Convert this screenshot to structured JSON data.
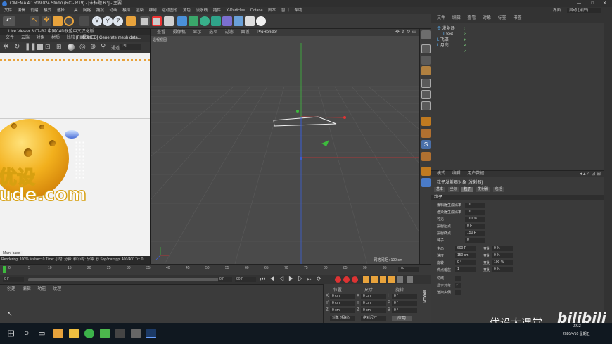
{
  "window": {
    "title": "CINEMA 4D R19.024 Studio (RC - R19) - [未标题 6 *] - 主要"
  },
  "menubar": [
    "文件",
    "编辑",
    "创建",
    "模式",
    "选择",
    "工具",
    "网格",
    "捕捉",
    "动画",
    "模拟",
    "渲染",
    "雕刻",
    "运动图形",
    "角色",
    "流水线",
    "插件",
    "X-Particles",
    "Octane",
    "脚本",
    "窗口",
    "帮助"
  ],
  "layout_label": "界面",
  "layout_value": "启动 (用户)",
  "live_viewer": {
    "title": "Live Viewer 3.07-R2 中国C4D联盟中文汉化版",
    "menu": [
      "文件",
      "云端",
      "对象",
      "材质",
      "比较",
      "帮助"
    ],
    "status_msg": "[FINISHED] Generate mesh data...",
    "render_label": "PT",
    "status_line": "Rendering: 100%   Ms/sec: 0   Time: 小时: 分钟: 秒/小时: 分钟: 秒   Spp/maxspp: 400/400   Tri: 0",
    "main_label": "Main: base"
  },
  "viewport": {
    "menu": [
      "查看",
      "摄像机",
      "显示",
      "选项",
      "过滤",
      "面板",
      "ProRender"
    ],
    "camera_label": "透视视图",
    "grid_scale": "网格间距 : 100 cm"
  },
  "object_manager": {
    "menu": [
      "文件",
      "编辑",
      "查看",
      "对象",
      "标签",
      "书签"
    ],
    "objects": [
      {
        "name": "发射器",
        "level": 0
      },
      {
        "name": "text",
        "level": 1
      },
      {
        "name": "飞碟",
        "level": 0
      },
      {
        "name": "月亮",
        "level": 0
      }
    ]
  },
  "attribute_manager": {
    "menu": [
      "模式",
      "编辑",
      "用户数据"
    ],
    "title": "粒子发射器对象 [发射器]",
    "tabs": [
      "基本",
      "坐标",
      "粒子",
      "发射器",
      "包括"
    ],
    "active_tab": "粒子",
    "section": "粒子",
    "params": [
      {
        "label": "编辑器生成比率",
        "value": "10"
      },
      {
        "label": "渲染器生成比率",
        "value": "10"
      },
      {
        "label": "可见",
        "value": "100 %"
      },
      {
        "label": "投射起点",
        "value": "0 F"
      },
      {
        "label": "投射终点",
        "value": "150 F"
      },
      {
        "label": "种子",
        "value": "0"
      },
      {
        "label": "生命",
        "value": "600 F",
        "var_label": "变化",
        "var_value": "0 %"
      },
      {
        "label": "速度",
        "value": "150 cm",
        "var_label": "变化",
        "var_value": "0 %"
      },
      {
        "label": "旋转",
        "value": "0 °",
        "var_label": "变化",
        "var_value": "100 %"
      },
      {
        "label": "终点缩放",
        "value": "1",
        "var_label": "变化",
        "var_value": "0 %"
      },
      {
        "label": "切线",
        "value": ""
      },
      {
        "label": "显示对象",
        "value": "✓"
      },
      {
        "label": "渲染实例",
        "value": ""
      }
    ]
  },
  "timeline": {
    "ticks": [
      "0",
      "5",
      "10",
      "15",
      "20",
      "25",
      "30",
      "35",
      "40",
      "45",
      "50",
      "55",
      "60",
      "65",
      "70",
      "75",
      "80",
      "85",
      "90",
      "95"
    ],
    "current_frame": "0 F",
    "start": "0 F",
    "end": "90 F",
    "field_a": "0 F",
    "field_b": "90 F"
  },
  "materials": {
    "menu": [
      "创建",
      "编辑",
      "功能",
      "纹理"
    ]
  },
  "coordinates": {
    "headers": [
      "位置",
      "尺寸",
      "旋转"
    ],
    "rows": [
      {
        "axis": "X",
        "pos": "0 cm",
        "size": "0 cm",
        "rot_label": "H",
        "rot": "0 °"
      },
      {
        "axis": "Y",
        "pos": "0 cm",
        "size": "0 cm",
        "rot_label": "P",
        "rot": "0 °"
      },
      {
        "axis": "Z",
        "pos": "0 cm",
        "size": "0 cm",
        "rot_label": "B",
        "rot": "0 °"
      }
    ],
    "mode": "对象 (相对)",
    "size_mode": "绝对尺寸",
    "apply": "应用"
  },
  "watermark": {
    "text": "优设大课堂",
    "brand": "bilibili"
  },
  "taskbar": {
    "time": "0:02",
    "date": "2020/4/10 星期五"
  },
  "logo_text": "优设\nude.com",
  "colors": {
    "accent": "#4a90d9",
    "toolbar_bg": "#3a3a3a",
    "viewport_bg": "#484848"
  }
}
